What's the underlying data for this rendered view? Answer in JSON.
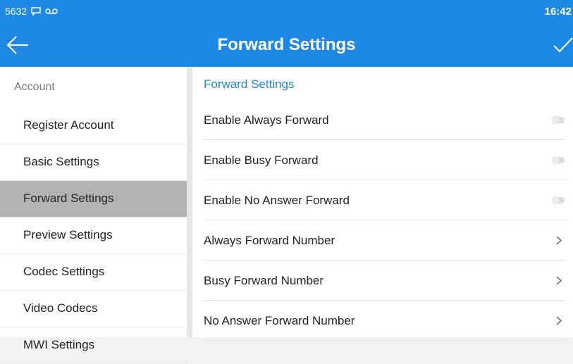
{
  "status_bar": {
    "left_text": "5632",
    "time": "16:42",
    "icons": [
      "message-icon",
      "voicemail-icon"
    ]
  },
  "app_bar": {
    "title": "Forward Settings",
    "back_icon": "arrow-left-icon",
    "confirm_icon": "check-icon"
  },
  "sidebar": {
    "section_label": "Account",
    "items": [
      {
        "label": "Register Account"
      },
      {
        "label": "Basic Settings"
      },
      {
        "label": "Forward Settings",
        "active": true
      },
      {
        "label": "Preview Settings"
      },
      {
        "label": "Codec Settings"
      },
      {
        "label": "Video Codecs"
      },
      {
        "label": "MWI Settings"
      }
    ]
  },
  "content": {
    "header": "Forward Settings",
    "rows": [
      {
        "label": "Enable Always Forward",
        "type": "toggle",
        "value": "off"
      },
      {
        "label": "Enable Busy Forward",
        "type": "toggle",
        "value": "off"
      },
      {
        "label": "Enable No Answer Forward",
        "type": "toggle",
        "value": "off"
      },
      {
        "label": "Always Forward Number",
        "type": "link"
      },
      {
        "label": "Busy Forward Number",
        "type": "link"
      },
      {
        "label": "No Answer Forward Number",
        "type": "link"
      }
    ]
  },
  "colors": {
    "accent": "#1e88e5",
    "active_item_bg": "#b3b3b3"
  }
}
